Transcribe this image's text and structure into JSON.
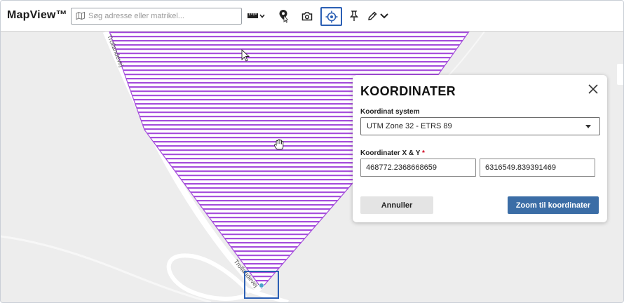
{
  "app": {
    "title": "MapView™"
  },
  "search": {
    "placeholder": "Søg adresse eller matrikel..."
  },
  "toolbar": {
    "tools": [
      "measure-tool",
      "pin-with-cursor-tool",
      "camera-tool",
      "target-coordinate-tool",
      "push-pin-tool",
      "draw-tool"
    ],
    "active_tool": "target-coordinate-tool"
  },
  "map": {
    "road_label": "Trollandevej"
  },
  "dialog": {
    "title": "KOORDINATER",
    "system_label": "Koordinat system",
    "system_value": "UTM Zone 32 - ETRS 89",
    "xy_label": "Koordinater X & Y",
    "required_mark": "*",
    "x_value": "468772.2368668659",
    "y_value": "6316549.839391469",
    "cancel_label": "Annuller",
    "zoom_label": "Zoom til koordinater"
  },
  "colors": {
    "accent": "#2b5fb4",
    "primary_button": "#3b6da6",
    "hatch": "#a64fdc",
    "map_bg": "#ededed"
  }
}
